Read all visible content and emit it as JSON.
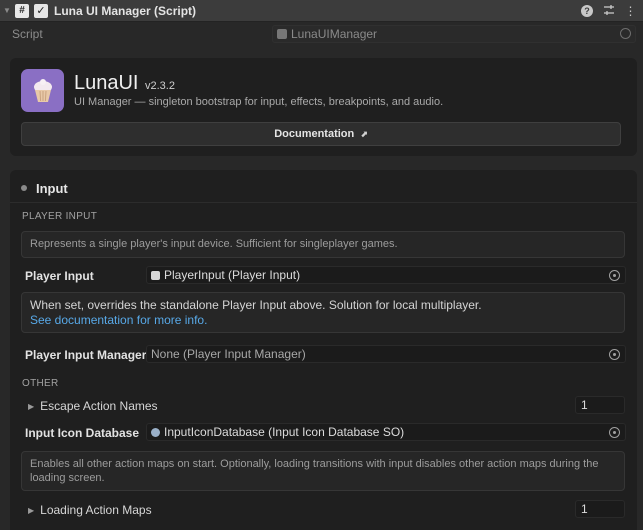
{
  "header": {
    "title": "Luna UI Manager (Script)",
    "script_icon_glyph": "#",
    "enabled_check_glyph": "✓",
    "icons": [
      "fold-arrow-icon",
      "script-icon",
      "help-icon",
      "preset-sliders-icon",
      "more-menu-icon"
    ]
  },
  "script_row": {
    "label": "Script",
    "value": "LunaUIManager"
  },
  "brand": {
    "name": "LunaUI",
    "version": "v2.3.2",
    "description": "UI Manager — singleton bootstrap for input, effects, breakpoints, and audio.",
    "doc_button": "Documentation",
    "logo_color": "#8a6fc4"
  },
  "input_section": {
    "title": "Input",
    "player_input_group": "PLAYER INPUT",
    "player_input_help": "Represents a single player's input device. Sufficient for singleplayer games.",
    "player_input_label": "Player Input",
    "player_input_value": "PlayerInput (Player Input)",
    "manager_help_text": "When set, overrides the standalone Player Input above. Solution for local multiplayer.",
    "manager_help_link": "See documentation for more info.",
    "player_input_manager_label": "Player Input Manager",
    "player_input_manager_value": "None (Player Input Manager)",
    "other_group": "OTHER",
    "escape_action_names_label": "Escape Action Names",
    "escape_action_names_count": "1",
    "input_icon_database_label": "Input Icon Database",
    "input_icon_database_value": "InputIconDatabase (Input Icon Database SO)",
    "action_maps_help": "Enables all other action maps on start. Optionally, loading transitions with input disables other action maps during the loading screen.",
    "loading_action_maps_label": "Loading Action Maps",
    "loading_action_maps_count": "1"
  },
  "colors": {
    "background": "#282828",
    "card": "#1f1f1f",
    "link": "#58a9e8"
  }
}
